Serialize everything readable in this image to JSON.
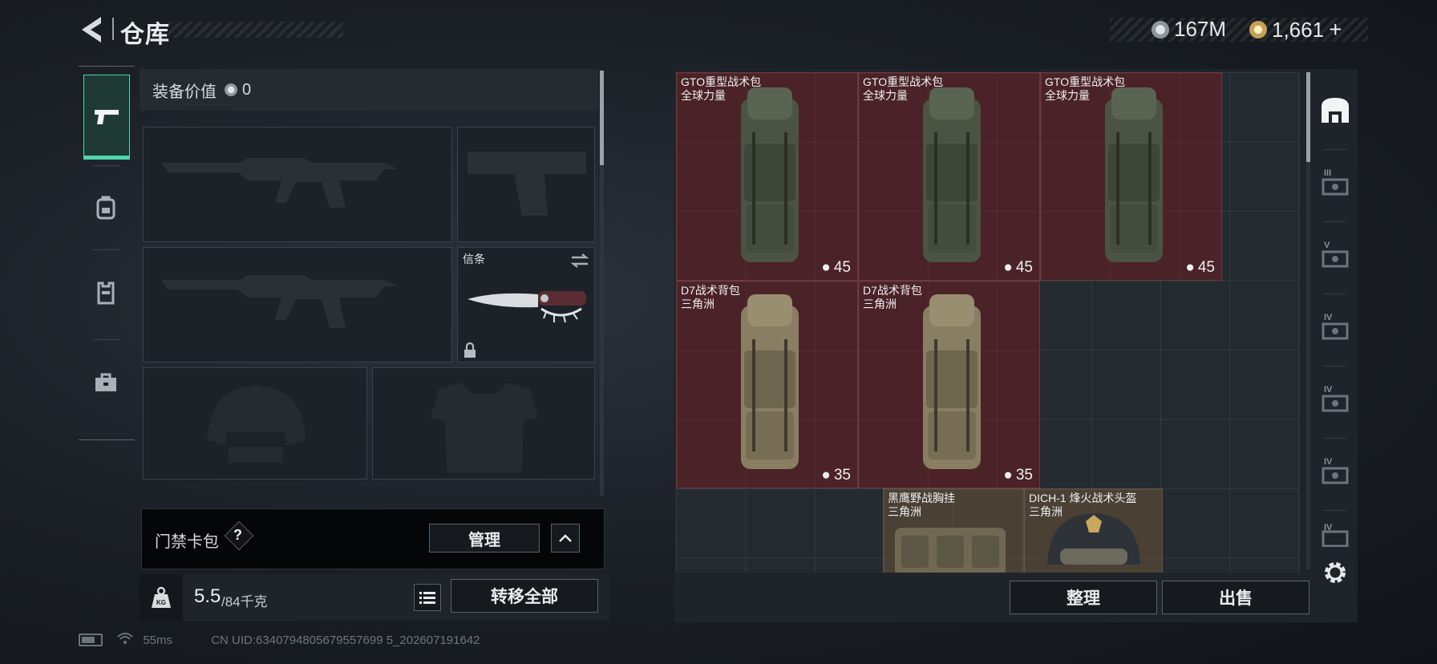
{
  "header": {
    "title": "仓库"
  },
  "currency": {
    "silver": "167M",
    "gold": "1,661",
    "add": "+"
  },
  "equipment": {
    "value_label": "装备价值",
    "value": "0",
    "melee_label": "信条"
  },
  "card_pack": {
    "label": "门禁卡包",
    "help": "?",
    "manage": "管理"
  },
  "weight": {
    "current": "5.5",
    "max": "/84千克",
    "kg_icon": "KG"
  },
  "transfer_all": "转移全部",
  "items": [
    {
      "name": "GTO重型战术包",
      "sub": "全球力量",
      "cap": "45"
    },
    {
      "name": "GTO重型战术包",
      "sub": "全球力量",
      "cap": "45"
    },
    {
      "name": "GTO重型战术包",
      "sub": "全球力量",
      "cap": "45"
    },
    {
      "name": "D7战术背包",
      "sub": "三角洲",
      "cap": "35"
    },
    {
      "name": "D7战术背包",
      "sub": "三角洲",
      "cap": "35"
    },
    {
      "name": "黑鹰野战胸挂",
      "sub": "三角洲"
    },
    {
      "name": "DICH-1 烽火战术头盔",
      "sub": "三角洲"
    }
  ],
  "side_tabs": [
    "III",
    "V",
    "IV",
    "IV",
    "IV",
    "IV"
  ],
  "actions": {
    "organize": "整理",
    "sell": "出售"
  },
  "footer": {
    "ping": "55ms",
    "uid": "CN UID:6340794805679557699 5_202607191642"
  },
  "colors": {
    "accent": "#4fd6a6",
    "item_red": "#4a2228",
    "item_brown": "#4a4034"
  }
}
